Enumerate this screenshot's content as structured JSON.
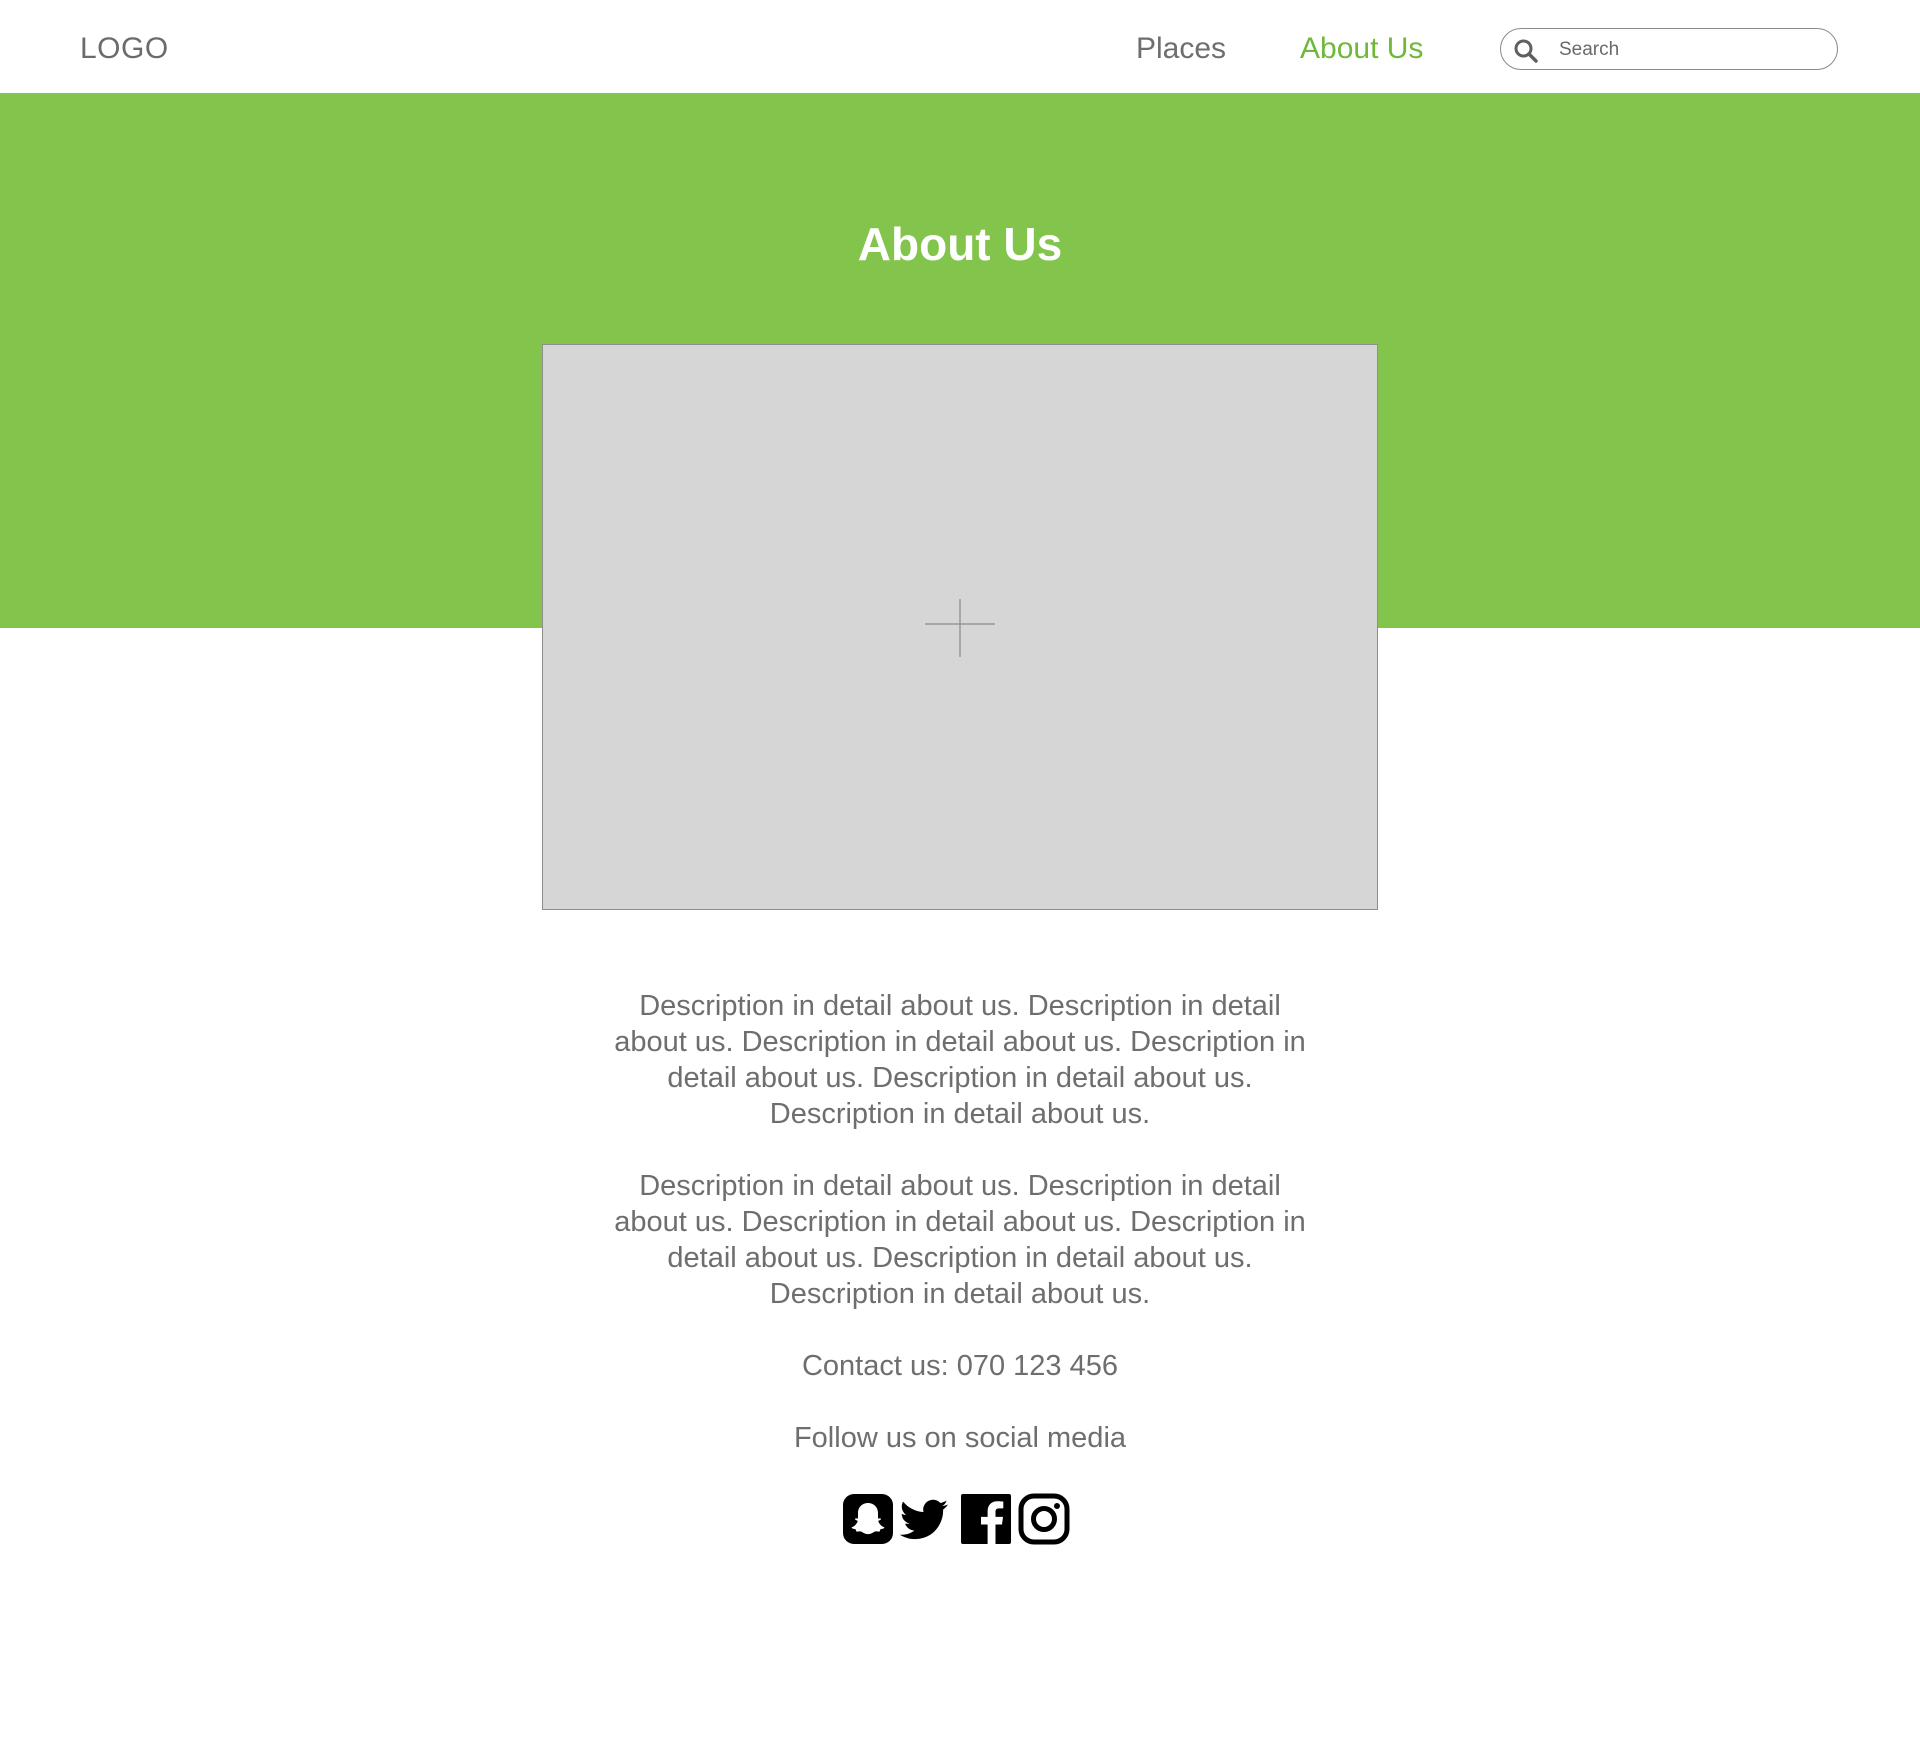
{
  "header": {
    "logo": "LOGO",
    "nav": [
      {
        "label": "Places",
        "active": false
      },
      {
        "label": "About Us",
        "active": true
      }
    ],
    "search": {
      "placeholder": "Search",
      "value": "",
      "icon": "search-icon"
    }
  },
  "hero": {
    "title": "About Us",
    "image": "image-placeholder"
  },
  "content": {
    "paragraphs": [
      "Description in detail about us. Description in detail about us. Description in detail about us. Description in detail about us. Description in detail about us. Description in detail about us.",
      "Description in detail about us. Description in detail about us. Description in detail about us. Description in detail about us. Description in detail about us. Description in detail about us."
    ],
    "contact": "Contact us: 070 123 456",
    "follow": "Follow us on social media"
  },
  "social": [
    {
      "icon": "snapchat-icon"
    },
    {
      "icon": "twitter-icon"
    },
    {
      "icon": "facebook-icon"
    },
    {
      "icon": "instagram-icon"
    }
  ],
  "colors": {
    "accent": "#83c44c",
    "active_nav": "#6fb83a",
    "text": "#6e6e6e",
    "placeholder_bg": "#d6d6d6"
  }
}
